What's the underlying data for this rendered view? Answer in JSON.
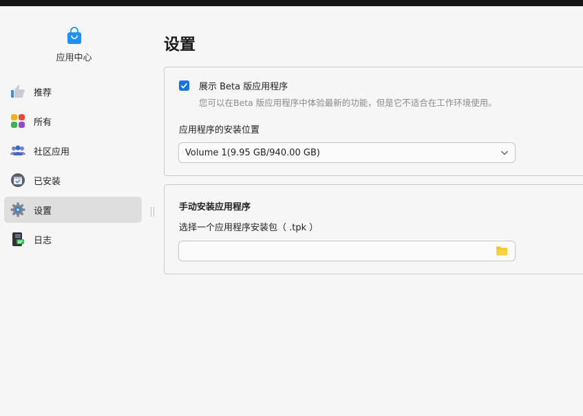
{
  "app": {
    "name": "应用中心"
  },
  "sidebar": {
    "items": [
      {
        "label": "推荐",
        "icon": "thumbs-up-icon"
      },
      {
        "label": "所有",
        "icon": "grid-apps-icon"
      },
      {
        "label": "社区应用",
        "icon": "community-icon"
      },
      {
        "label": "已安装",
        "icon": "installed-box-icon"
      },
      {
        "label": "设置",
        "icon": "gear-icon",
        "active": true
      },
      {
        "label": "日志",
        "icon": "log-icon"
      }
    ]
  },
  "main": {
    "title": "设置",
    "beta": {
      "checked": true,
      "label": "展示 Beta 版应用程序",
      "description": "您可以在Beta 版应用程序中体验最新的功能，但是它不适合在工作环境使用。"
    },
    "install_location": {
      "label": "应用程序的安装位置",
      "value": "Volume 1(9.95 GB/940.00 GB)"
    },
    "manual_install": {
      "title": "手动安装应用程序",
      "file_label": "选择一个应用程序安装包（ .tpk ）",
      "file_value": ""
    }
  },
  "colors": {
    "accent": "#1a73d9",
    "folder": "#f5c518",
    "active_nav_bg": "#dedede"
  }
}
